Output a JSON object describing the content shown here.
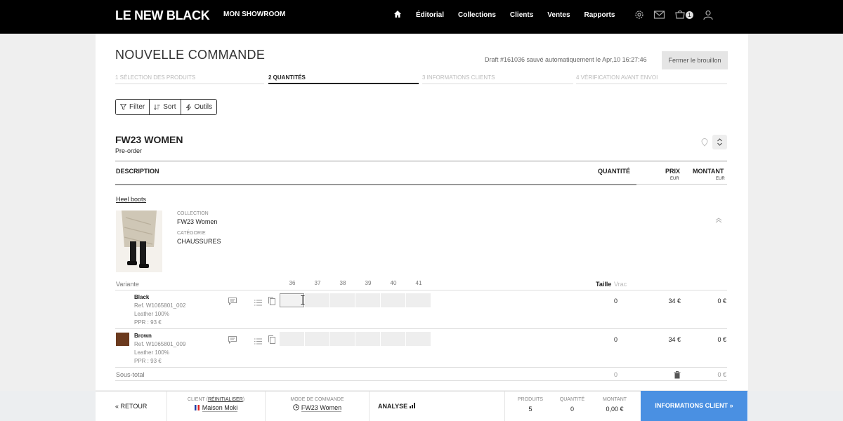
{
  "header": {
    "logo": "LE NEW BLACK",
    "showroom": "MON SHOWROOM",
    "nav": [
      "Éditorial",
      "Collections",
      "Clients",
      "Ventes",
      "Rapports"
    ],
    "cart_count": "1",
    "icons": [
      "home-icon",
      "gear-icon",
      "mail-icon",
      "cart-icon",
      "user-icon"
    ]
  },
  "page": {
    "title": "NOUVELLE COMMANDE",
    "draft_text": "Draft #161036 sauvé automatiquement le Apr,10 16:27:46",
    "close_draft": "Fermer le brouillon"
  },
  "steps": [
    {
      "label": "1 SÉLECTION DES PRODUITS",
      "active": false
    },
    {
      "label": "2 QUANTITÉS",
      "active": true
    },
    {
      "label": "3 INFORMATIONS CLIENTS",
      "active": false
    },
    {
      "label": "4 VÉRIFICATION AVANT ENVOI",
      "active": false
    }
  ],
  "tools": {
    "filter": "Filter",
    "sort": "Sort",
    "outils": "Outils"
  },
  "season": {
    "title": "FW23 WOMEN",
    "subtitle": "Pre-order"
  },
  "table": {
    "description": "DESCRIPTION",
    "quantite": "QUANTITÉ",
    "prix": "PRIX",
    "prix_unit": "EUR",
    "montant": "MONTANT",
    "montant_unit": "EUR"
  },
  "product": {
    "name": "Heel boots",
    "collection_label": "COLLECTION",
    "collection": "FW23 Women",
    "category_label": "CATÉGORIE",
    "category": "CHAUSSURES",
    "variant_label": "Variante",
    "sizes": [
      "36",
      "37",
      "38",
      "39",
      "40",
      "41"
    ],
    "taille_label": "Taille",
    "vrac_label": "Vrac",
    "variants": [
      {
        "name": "Black",
        "ref": "Ref. W1065801_002",
        "material": "Leather 100%",
        "ppr": "PPR : 93 €",
        "qty": "0",
        "price": "34 €",
        "amount": "0 €",
        "swatch": ""
      },
      {
        "name": "Brown",
        "ref": "Ref. W1065801_009",
        "material": "Leather 100%",
        "ppr": "PPR : 93 €",
        "qty": "0",
        "price": "34 €",
        "amount": "0 €",
        "swatch": "#6b3a1e"
      }
    ],
    "subtotal_label": "Sous-total",
    "subtotal_qty": "0",
    "subtotal_amount": "0 €"
  },
  "footer": {
    "retour": "« RETOUR",
    "client_label_prefix": "CLIENT (",
    "client_reset": "RÉINITIALISER",
    "client_label_suffix": ")",
    "client_name": "Maison Moki",
    "mode_label": "MODE DE COMMANDE",
    "mode_value": "FW23 Women",
    "analyse": "ANALYSE",
    "produits_label": "PRODUITS",
    "produits_value": "5",
    "quantite_label": "QUANTITÉ",
    "quantite_value": "0",
    "montant_label": "MONTANT",
    "montant_value": "0,00 €",
    "info_button": "INFORMATIONS CLIENT »"
  }
}
